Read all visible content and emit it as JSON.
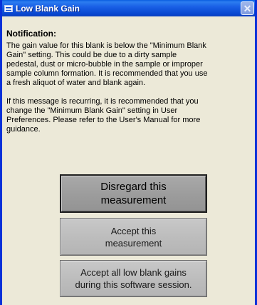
{
  "window": {
    "title": "Low Blank Gain",
    "close_glyph": "✕"
  },
  "notification": {
    "heading": "Notification:",
    "paragraph1": "The gain value for this blank is below the \"Minimum Blank\nGain\" setting.  This could be due to a dirty sample\npedestal, dust or micro-bubble in the sample or improper\nsample column formation.  It is recommended that you use\na fresh aliquot of water and blank again.",
    "paragraph2": "If this message is recurring, it is recommended that you\nchange the \"Minimum Blank Gain\" setting in User\nPreferences. Please refer to the User's Manual for more\nguidance."
  },
  "buttons": {
    "disregard": "Disregard this\nmeasurement",
    "accept": "Accept this\nmeasurement",
    "accept_all": "Accept all low blank gains\nduring this software session."
  },
  "colors": {
    "titlebar": "#0846d0",
    "dialog_bg": "#ece9d8",
    "button_gray": "#bdbdbd"
  },
  "icons": {
    "title": "app-window-icon",
    "close": "close-icon"
  }
}
